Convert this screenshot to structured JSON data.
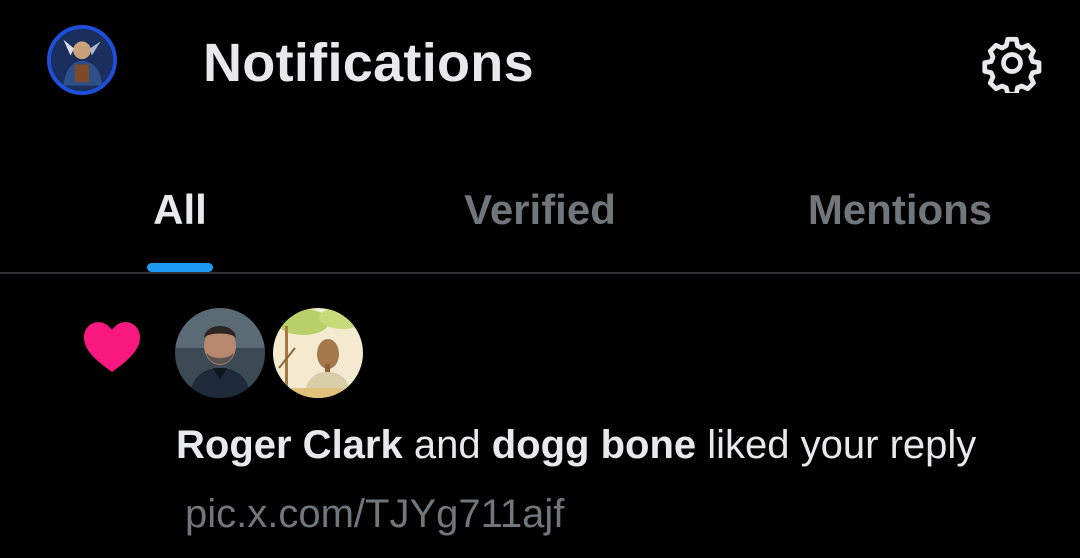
{
  "header": {
    "title": "Notifications",
    "profile_icon": "profile-avatar",
    "settings_icon": "gear-icon"
  },
  "tabs": [
    {
      "label": "All",
      "active": true
    },
    {
      "label": "Verified",
      "active": false
    },
    {
      "label": "Mentions",
      "active": false
    }
  ],
  "notification": {
    "icon": "heart-icon",
    "accent_color": "#f91880",
    "user1": "Roger Clark",
    "connector": "and",
    "user2": "dogg bone",
    "action": "liked your reply",
    "link": "pic.x.com/TJYg711ajf"
  },
  "colors": {
    "background": "#000000",
    "text_primary": "#e7e9ea",
    "text_secondary": "#71767b",
    "tab_indicator": "#1d9bf0",
    "divider": "#2f3336"
  }
}
